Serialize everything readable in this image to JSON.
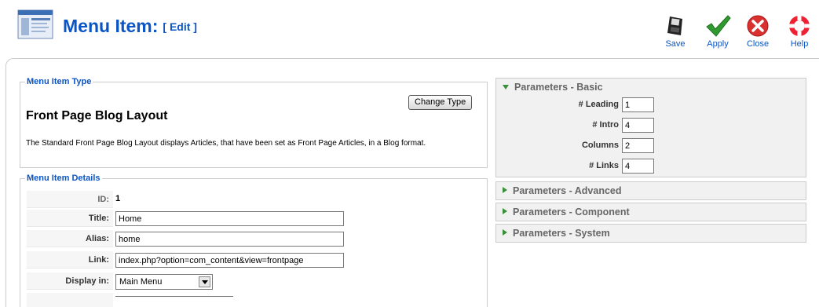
{
  "header": {
    "title": "Menu Item:",
    "subtitle": "[ Edit ]"
  },
  "toolbar": {
    "save_label": "Save",
    "apply_label": "Apply",
    "close_label": "Close",
    "help_label": "Help"
  },
  "menu_item_type": {
    "legend": "Menu Item Type",
    "change_button": "Change Type",
    "heading": "Front Page Blog Layout",
    "description": "The Standard Front Page Blog Layout displays Articles, that have been set as Front Page Articles, in a Blog format."
  },
  "menu_item_details": {
    "legend": "Menu Item Details",
    "id_label": "ID:",
    "id_value": "1",
    "title_label": "Title:",
    "title_value": "Home",
    "alias_label": "Alias:",
    "alias_value": "home",
    "link_label": "Link:",
    "link_value": "index.php?option=com_content&view=frontpage",
    "display_label": "Display in:",
    "display_value": "Main Menu"
  },
  "parameters": {
    "basic": {
      "title": "Parameters - Basic",
      "fields": [
        {
          "label": "# Leading",
          "value": "1"
        },
        {
          "label": "# Intro",
          "value": "4"
        },
        {
          "label": "Columns",
          "value": "2"
        },
        {
          "label": "# Links",
          "value": "4"
        }
      ]
    },
    "advanced": {
      "title": "Parameters - Advanced"
    },
    "component": {
      "title": "Parameters - Component"
    },
    "system": {
      "title": "Parameters - System"
    }
  },
  "colors": {
    "accent": "#0b55c4",
    "panel_bg": "#f1f1f1",
    "expander": "#3a8f3a"
  },
  "icons": {
    "logo": "menu-manager-icon",
    "save": "floppy-disk-icon",
    "apply": "checkmark-icon",
    "close": "close-circle-icon",
    "help": "lifebuoy-icon"
  }
}
